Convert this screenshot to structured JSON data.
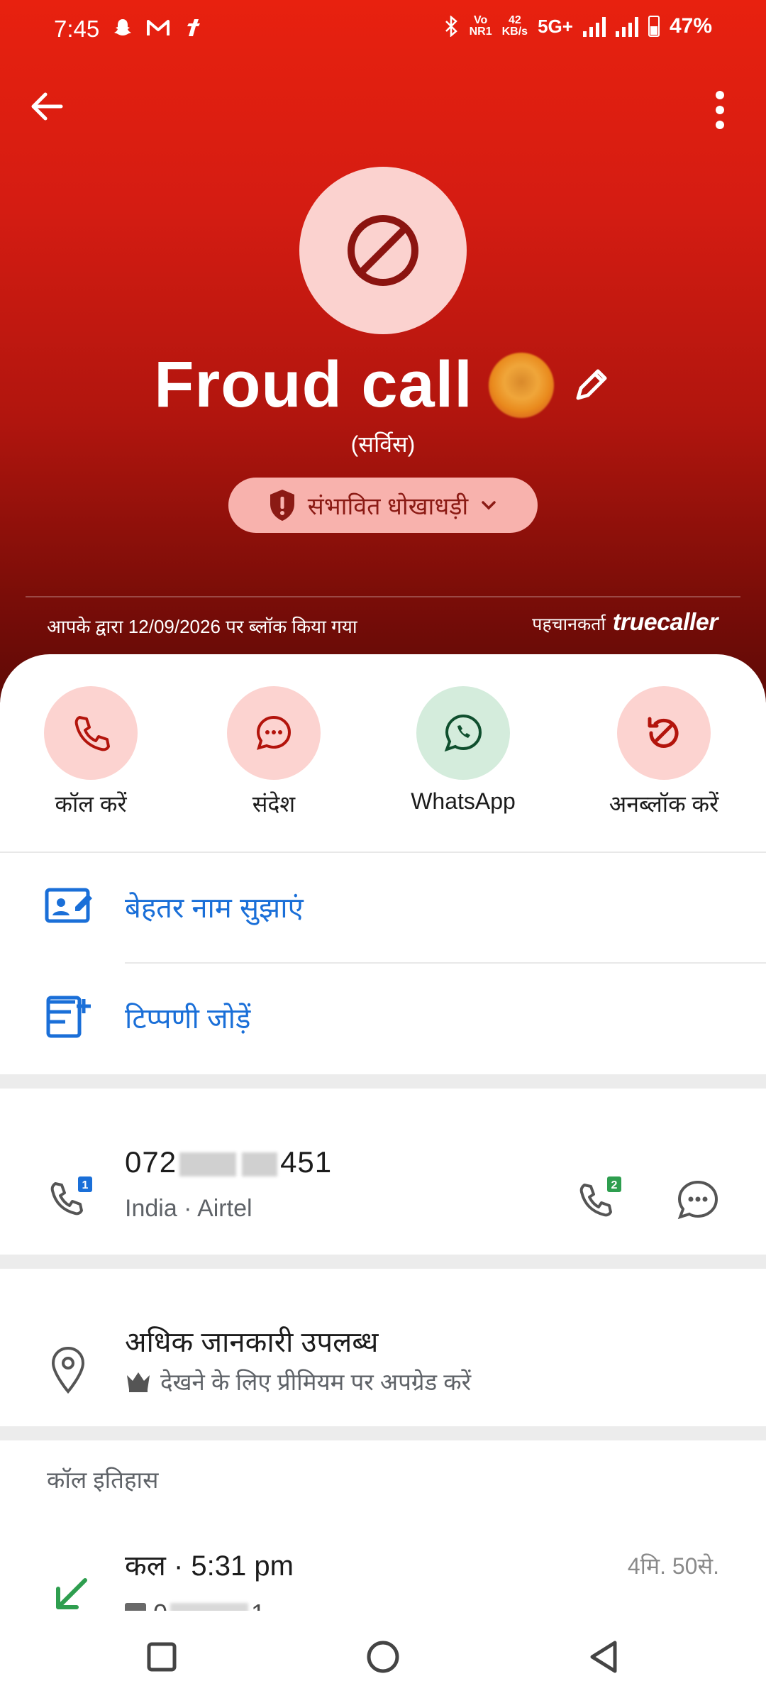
{
  "status": {
    "time": "7:45",
    "net_top": "Vo",
    "net_bottom": "NR1",
    "speed_top": "42",
    "speed_bottom": "KB/s",
    "network": "5G+",
    "battery": "47%"
  },
  "contact": {
    "name": "Froud call",
    "subtitle": "(सर्विस)",
    "spam_label": "संभावित धोखाधड़ी",
    "blocked_text": "आपके द्वारा 12/09/2026 पर ब्लॉक किया गया",
    "identified_label": "पहचानकर्ता",
    "brand": "truecaller"
  },
  "actions": [
    {
      "label": "कॉल करें"
    },
    {
      "label": "संदेश"
    },
    {
      "label": "WhatsApp"
    },
    {
      "label": "अनब्लॉक करें"
    }
  ],
  "links": {
    "suggest_name": "बेहतर नाम सुझाएं",
    "add_note": "टिप्पणी जोड़ें"
  },
  "number": {
    "prefix": "072",
    "suffix": "451",
    "sim1": "1",
    "sim2": "2",
    "carrier": "India · Airtel"
  },
  "info": {
    "title": "अधिक जानकारी उपलब्ध",
    "subtitle": "देखने के लिए प्रीमियम पर अपग्रेड करें"
  },
  "history": {
    "title": "कॉल इतिहास",
    "items": [
      {
        "time": "कल · 5:31 pm",
        "duration": "4मि. 50से.",
        "number_prefix": "0",
        "number_suffix": "1"
      }
    ]
  },
  "colors": {
    "brand_red": "#e8210f",
    "link_blue": "#1a6fd8",
    "pink_circle": "#fcd3d0",
    "green_circle": "#d4ecdc"
  }
}
